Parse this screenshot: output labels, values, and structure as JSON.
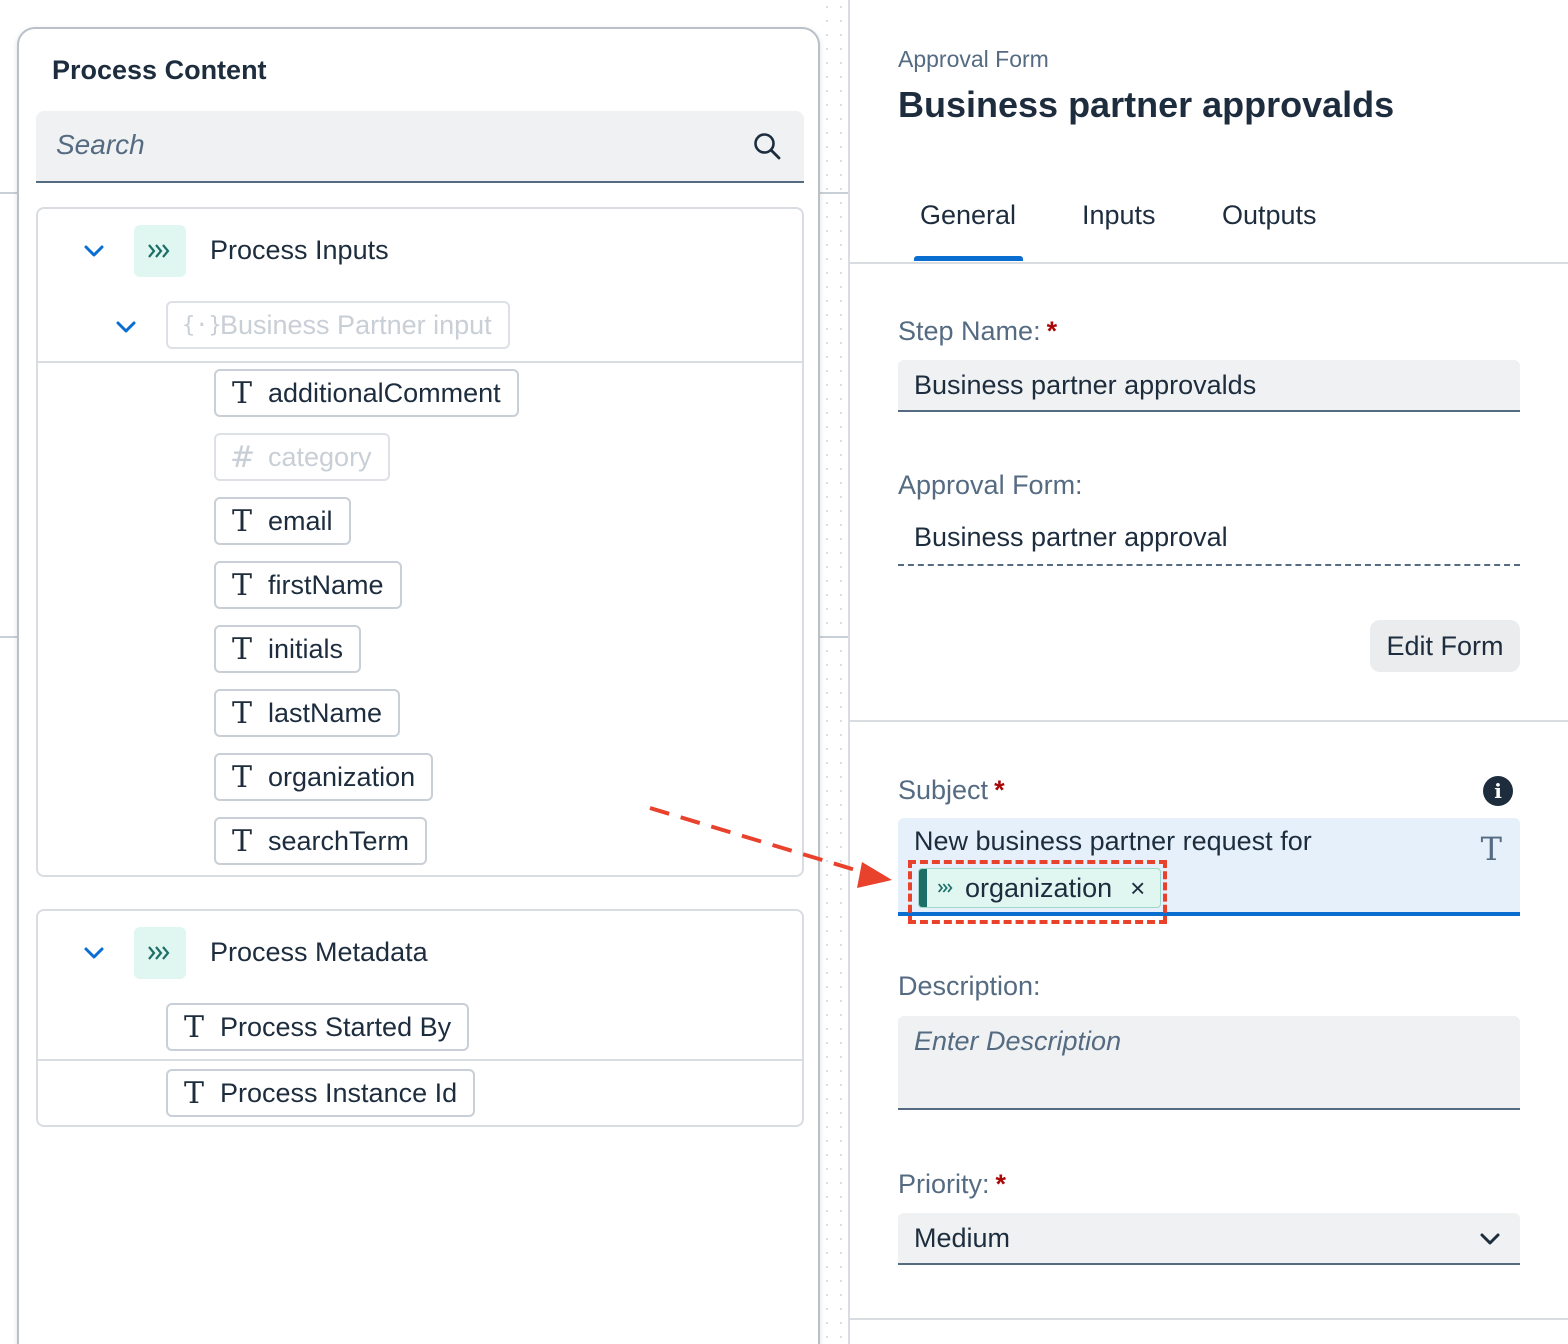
{
  "left_panel": {
    "title": "Process Content",
    "search": {
      "placeholder": "Search"
    },
    "process_inputs": {
      "label": "Process Inputs",
      "sub_group": "Business Partner input",
      "fields": [
        {
          "name": "additionalComment",
          "icon": "text-type-icon",
          "disabled": false
        },
        {
          "name": "category",
          "icon": "number-type-icon",
          "disabled": true
        },
        {
          "name": "email",
          "icon": "text-type-icon",
          "disabled": false
        },
        {
          "name": "firstName",
          "icon": "text-type-icon",
          "disabled": false
        },
        {
          "name": "initials",
          "icon": "text-type-icon",
          "disabled": false
        },
        {
          "name": "lastName",
          "icon": "text-type-icon",
          "disabled": false
        },
        {
          "name": "organization",
          "icon": "text-type-icon",
          "disabled": false
        },
        {
          "name": "searchTerm",
          "icon": "text-type-icon",
          "disabled": false
        }
      ]
    },
    "process_metadata": {
      "label": "Process Metadata",
      "fields": [
        {
          "name": "Process Started By",
          "icon": "text-type-icon"
        },
        {
          "name": "Process Instance Id",
          "icon": "text-type-icon"
        }
      ]
    }
  },
  "right_panel": {
    "breadcrumb": "Approval Form",
    "title": "Business partner approvalds",
    "tabs": [
      {
        "label": "General",
        "selected": true
      },
      {
        "label": "Inputs",
        "selected": false
      },
      {
        "label": "Outputs",
        "selected": false
      }
    ],
    "step_name": {
      "label": "Step Name:",
      "required_mark": "*",
      "value": "Business partner approvalds"
    },
    "approval_form": {
      "label": "Approval Form:",
      "value": "Business partner approval"
    },
    "edit_form_button": "Edit Form",
    "subject": {
      "label": "Subject",
      "required_mark": "*",
      "text": "New business partner request for",
      "variable_chip": "organization",
      "chip_remove": "×"
    },
    "description": {
      "label": "Description:",
      "placeholder": "Enter Description"
    },
    "priority": {
      "label": "Priority:",
      "required_mark": "*",
      "value": "Medium"
    }
  },
  "colors": {
    "accent": "#0a6ed1",
    "highlight": "#e8412c",
    "variable_chip_bg": "#dff6f1",
    "required": "#aa0808"
  }
}
